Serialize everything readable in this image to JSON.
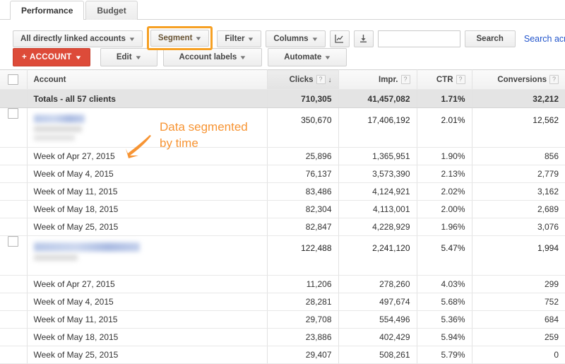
{
  "tabs": [
    {
      "label": "Performance",
      "active": true
    },
    {
      "label": "Budget",
      "active": false
    }
  ],
  "toolbar": {
    "accounts_filter": "All directly linked accounts",
    "segment": "Segment",
    "filter": "Filter",
    "columns": "Columns",
    "chart_icon": "chart-icon",
    "download_icon": "download-icon",
    "search_value": "",
    "search_placeholder": "",
    "search_button": "Search",
    "search_across_accounts": "Search across accounts",
    "caret": "▼"
  },
  "toolbar2": {
    "account_button": "ACCOUNT",
    "plus": "+",
    "edit": "Edit",
    "account_labels": "Account labels",
    "automate": "Automate"
  },
  "table": {
    "columns": [
      {
        "key": "account",
        "label": "Account",
        "align": "left",
        "help": false,
        "sorted": false
      },
      {
        "key": "clicks",
        "label": "Clicks",
        "align": "right",
        "help": true,
        "sorted": true,
        "sort_arrow": "↓"
      },
      {
        "key": "impr",
        "label": "Impr.",
        "align": "right",
        "help": true,
        "sorted": false
      },
      {
        "key": "ctr",
        "label": "CTR",
        "align": "right",
        "help": true,
        "sorted": false
      },
      {
        "key": "conversions",
        "label": "Conversions",
        "align": "right",
        "help": true,
        "sorted": false
      }
    ],
    "help_glyph": "?",
    "totals": {
      "label": "Totals - all 57 clients",
      "clicks": "710,305",
      "impr": "41,457,082",
      "ctr": "1.71%",
      "conversions": "32,212"
    },
    "accounts": [
      {
        "name_redacted": true,
        "clicks": "350,670",
        "impr": "17,406,192",
        "ctr": "2.01%",
        "conversions": "12,562",
        "segments": [
          {
            "label": "Week of Apr 27, 2015",
            "clicks": "25,896",
            "impr": "1,365,951",
            "ctr": "1.90%",
            "conversions": "856"
          },
          {
            "label": "Week of May 4, 2015",
            "clicks": "76,137",
            "impr": "3,573,390",
            "ctr": "2.13%",
            "conversions": "2,779"
          },
          {
            "label": "Week of May 11, 2015",
            "clicks": "83,486",
            "impr": "4,124,921",
            "ctr": "2.02%",
            "conversions": "3,162"
          },
          {
            "label": "Week of May 18, 2015",
            "clicks": "82,304",
            "impr": "4,113,001",
            "ctr": "2.00%",
            "conversions": "2,689"
          },
          {
            "label": "Week of May 25, 2015",
            "clicks": "82,847",
            "impr": "4,228,929",
            "ctr": "1.96%",
            "conversions": "3,076"
          }
        ]
      },
      {
        "name_redacted": true,
        "clicks": "122,488",
        "impr": "2,241,120",
        "ctr": "5.47%",
        "conversions": "1,994",
        "segments": [
          {
            "label": "Week of Apr 27, 2015",
            "clicks": "11,206",
            "impr": "278,260",
            "ctr": "4.03%",
            "conversions": "299"
          },
          {
            "label": "Week of May 4, 2015",
            "clicks": "28,281",
            "impr": "497,674",
            "ctr": "5.68%",
            "conversions": "752"
          },
          {
            "label": "Week of May 11, 2015",
            "clicks": "29,708",
            "impr": "554,496",
            "ctr": "5.36%",
            "conversions": "684"
          },
          {
            "label": "Week of May 18, 2015",
            "clicks": "23,886",
            "impr": "402,429",
            "ctr": "5.94%",
            "conversions": "259"
          },
          {
            "label": "Week of May 25, 2015",
            "clicks": "29,407",
            "impr": "508,261",
            "ctr": "5.79%",
            "conversions": "0"
          }
        ]
      }
    ]
  },
  "annotation": {
    "line1": "Data segmented",
    "line2": "by time",
    "color": "#f79433",
    "arrow_icon": "arrow-down-left-icon"
  }
}
